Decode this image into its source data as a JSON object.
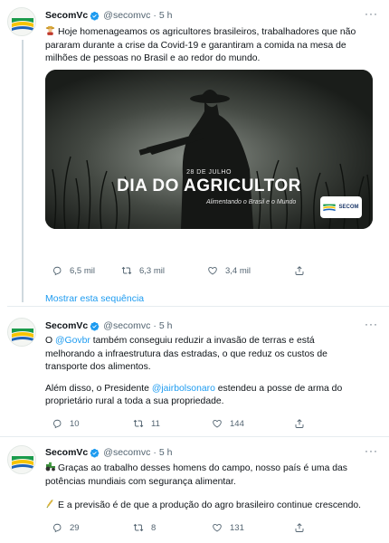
{
  "tweets": [
    {
      "display_name": "SecomVc",
      "handle": "@secomvc",
      "time": "5 h",
      "text_lines": [
        "Hoje homenageamos os agricultores brasileiros, trabalhadores que não",
        "pararam durante a crise da Covid-19 e garantiram a comida na mesa de",
        "milhões de pessoas no Brasil e ao redor do mundo."
      ],
      "leading_emoji": "farmer-emoji",
      "media": {
        "date": "28 DE JULHO",
        "title": "DIA DO AGRICULTOR",
        "subtitle": "Alimentando o Brasil e o Mundo",
        "logo_text": "SECOM"
      },
      "replies": "6,5 mil",
      "retweets": "6,3 mil",
      "likes": "3,4 mil"
    },
    {
      "display_name": "SecomVc",
      "handle": "@secomvc",
      "time": "5 h",
      "p1": {
        "before": "O ",
        "mention": "@Govbr",
        "after": " também conseguiu reduzir a invasão de terras e está",
        "line2": "melhorando a infraestrutura das estradas, o que reduz os custos de",
        "line3": "transporte dos alimentos."
      },
      "p2": {
        "before": "Além disso, o Presidente ",
        "mention": "@jairbolsonaro",
        "after": " estendeu a posse de arma do",
        "line2": "proprietário rural a toda a sua propriedade."
      },
      "replies": "10",
      "retweets": "11",
      "likes": "144"
    },
    {
      "display_name": "SecomVc",
      "handle": "@secomvc",
      "time": "5 h",
      "p1": {
        "line1": "Graças ao trabalho desses homens do campo, nosso país é uma das",
        "line2": "potências mundiais com segurança alimentar."
      },
      "p2": {
        "line1": "E a previsão é de que a produção do agro brasileiro continue crescendo."
      },
      "replies": "29",
      "retweets": "8",
      "likes": "131"
    }
  ],
  "show_thread_label": "Mostrar esta sequência",
  "colors": {
    "link": "#1d9bf0",
    "secondary": "#536471",
    "verified": "#1d9bf0"
  }
}
